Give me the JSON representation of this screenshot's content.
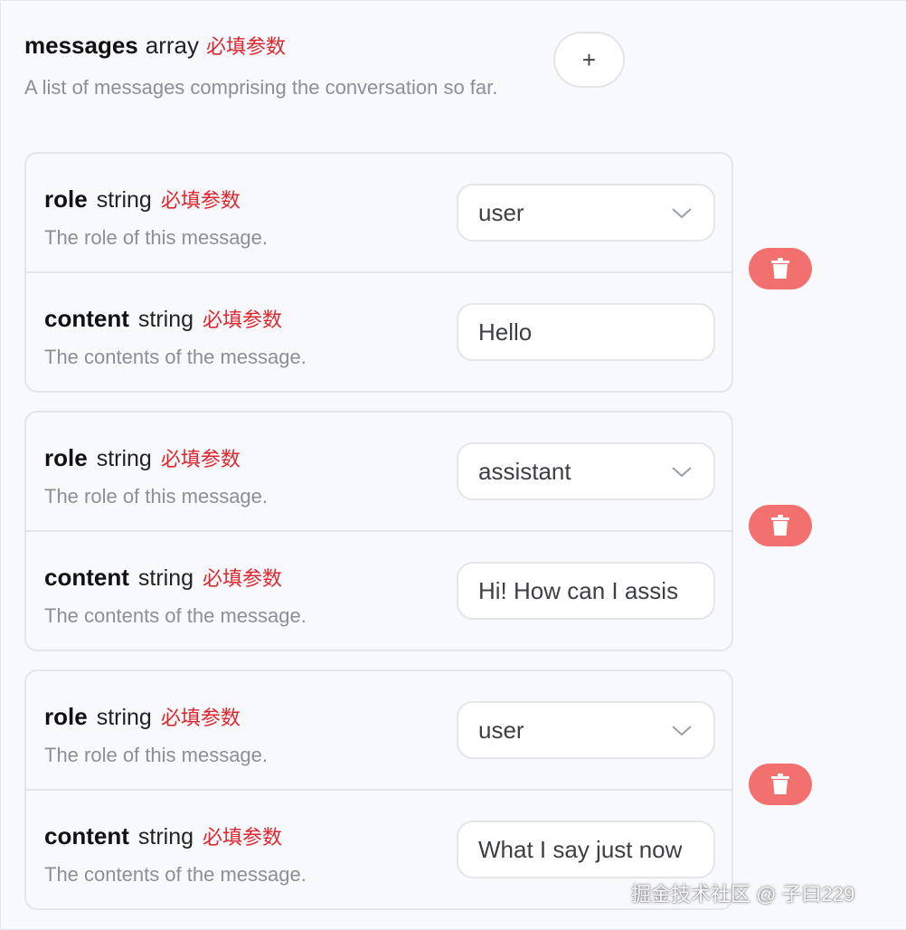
{
  "param": {
    "name": "messages",
    "type": "array",
    "required_tag": "必填参数",
    "description": "A list of messages comprising the conversation so far.",
    "add_label": "+"
  },
  "messages": [
    {
      "role": {
        "name": "role",
        "type": "string",
        "required_tag": "必填参数",
        "description": "The role of this message.",
        "value": "user"
      },
      "content": {
        "name": "content",
        "type": "string",
        "required_tag": "必填参数",
        "description": "The contents of the message.",
        "value": "Hello"
      }
    },
    {
      "role": {
        "name": "role",
        "type": "string",
        "required_tag": "必填参数",
        "description": "The role of this message.",
        "value": "assistant"
      },
      "content": {
        "name": "content",
        "type": "string",
        "required_tag": "必填参数",
        "description": "The contents of the message.",
        "value": "Hi! How can I assis"
      }
    },
    {
      "role": {
        "name": "role",
        "type": "string",
        "required_tag": "必填参数",
        "description": "The role of this message.",
        "value": "user"
      },
      "content": {
        "name": "content",
        "type": "string",
        "required_tag": "必填参数",
        "description": "The contents of the message.",
        "value": "What I say just now"
      }
    }
  ],
  "icons": {
    "delete": "trash-icon",
    "dropdown": "chevron-down-icon",
    "add": "plus-icon"
  },
  "colors": {
    "required": "#e0262d",
    "delete_button": "#f2706e",
    "border": "#e3e5e9",
    "description": "#8a8f98"
  },
  "watermark": "掘金技术社区 @ 子曰229"
}
